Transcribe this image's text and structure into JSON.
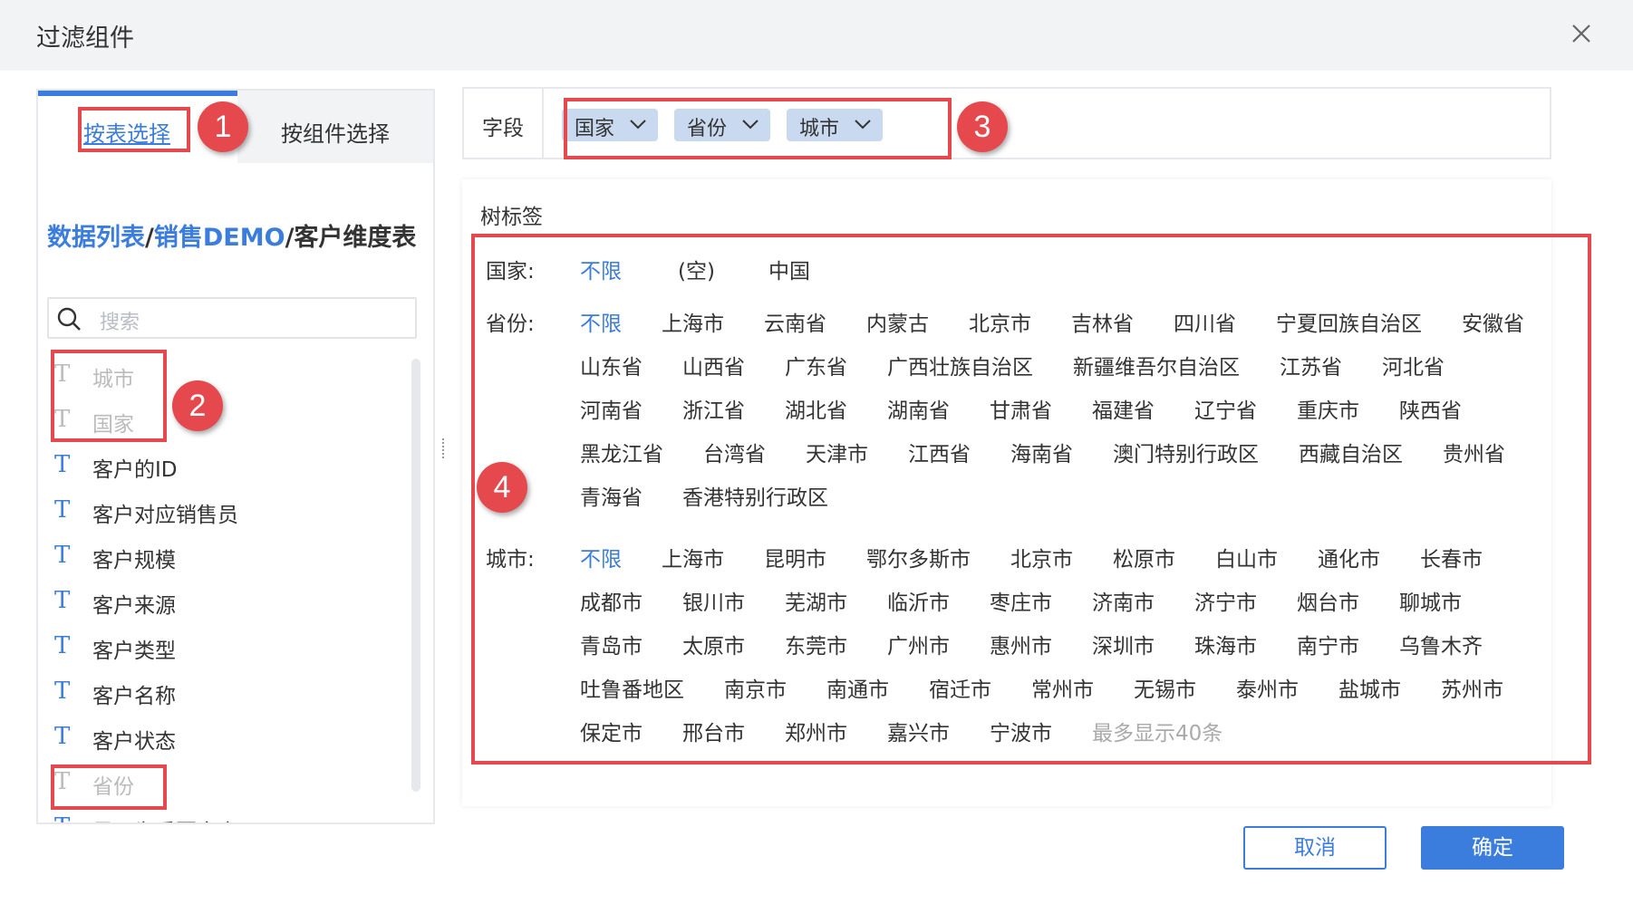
{
  "dialog": {
    "title": "过滤组件"
  },
  "tabs": {
    "by_table": "按表选择",
    "by_component": "按组件选择"
  },
  "breadcrumb": {
    "part1": "数据列表",
    "sep1": "/",
    "part2": "销售DEMO",
    "sep2": "/",
    "part3": "客户维度表"
  },
  "search": {
    "placeholder": "搜索"
  },
  "fields": [
    {
      "label": "城市",
      "muted": true
    },
    {
      "label": "国家",
      "muted": true
    },
    {
      "label": "客户的ID",
      "muted": false
    },
    {
      "label": "客户对应销售员",
      "muted": false
    },
    {
      "label": "客户规模",
      "muted": false
    },
    {
      "label": "客户来源",
      "muted": false
    },
    {
      "label": "客户类型",
      "muted": false
    },
    {
      "label": "客户名称",
      "muted": false
    },
    {
      "label": "客户状态",
      "muted": false
    },
    {
      "label": "省份",
      "muted": true
    },
    {
      "label": "是否为重要客户",
      "muted": false
    }
  ],
  "field_row": {
    "label": "字段",
    "chips": [
      "国家",
      "省份",
      "城市"
    ]
  },
  "tree": {
    "title": "树标签",
    "country": {
      "label": "国家:",
      "options": [
        "不限",
        "(空)",
        "中国"
      ]
    },
    "province": {
      "label": "省份:",
      "lines": [
        [
          "不限",
          "上海市",
          "云南省",
          "内蒙古",
          "北京市",
          "吉林省",
          "四川省",
          "宁夏回族自治区",
          "安徽省"
        ],
        [
          "山东省",
          "山西省",
          "广东省",
          "广西壮族自治区",
          "新疆维吾尔自治区",
          "江苏省",
          "河北省"
        ],
        [
          "河南省",
          "浙江省",
          "湖北省",
          "湖南省",
          "甘肃省",
          "福建省",
          "辽宁省",
          "重庆市",
          "陕西省"
        ],
        [
          "黑龙江省",
          "台湾省",
          "天津市",
          "江西省",
          "海南省",
          "澳门特别行政区",
          "西藏自治区",
          "贵州省"
        ],
        [
          "青海省",
          "香港特别行政区"
        ]
      ]
    },
    "city": {
      "label": "城市:",
      "lines": [
        [
          "不限",
          "上海市",
          "昆明市",
          "鄂尔多斯市",
          "北京市",
          "松原市",
          "白山市",
          "通化市",
          "长春市"
        ],
        [
          "成都市",
          "银川市",
          "芜湖市",
          "临沂市",
          "枣庄市",
          "济南市",
          "济宁市",
          "烟台市",
          "聊城市"
        ],
        [
          "青岛市",
          "太原市",
          "东莞市",
          "广州市",
          "惠州市",
          "深圳市",
          "珠海市",
          "南宁市",
          "乌鲁木齐"
        ],
        [
          "吐鲁番地区",
          "南京市",
          "南通市",
          "宿迁市",
          "常州市",
          "无锡市",
          "泰州市",
          "盐城市",
          "苏州市"
        ],
        [
          "保定市",
          "邢台市",
          "郑州市",
          "嘉兴市",
          "宁波市",
          "最多显示40条"
        ]
      ]
    }
  },
  "annotations": [
    "1",
    "2",
    "3",
    "4"
  ],
  "footer": {
    "cancel": "取消",
    "ok": "确定"
  },
  "colors": {
    "accent": "#3b7ddd",
    "annotation": "#e5484d",
    "chip": "#c9d9ef"
  }
}
